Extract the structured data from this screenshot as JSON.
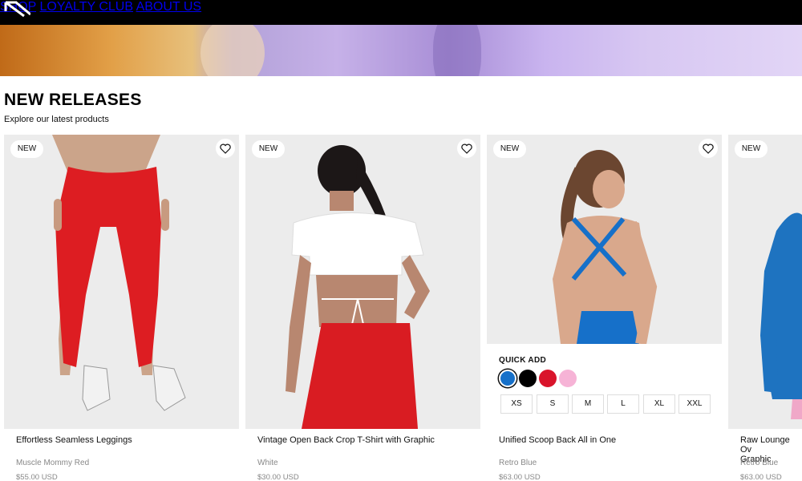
{
  "nav": {
    "items": [
      "SHOP",
      "LOYALTY CLUB",
      "ABOUT US"
    ]
  },
  "section": {
    "title": "NEW RELEASES",
    "subtitle": "Explore our latest products"
  },
  "products": [
    {
      "badge": "NEW",
      "name": "Effortless Seamless Leggings",
      "color": "Muscle Mommy Red",
      "price": "$55.00 USD"
    },
    {
      "badge": "NEW",
      "name": "Vintage Open Back Crop T-Shirt with Graphic",
      "color": "White",
      "price": "$30.00 USD"
    },
    {
      "badge": "NEW",
      "name": "Unified Scoop Back All in One",
      "color": "Retro Blue",
      "price": "$63.00 USD"
    },
    {
      "badge": "NEW",
      "name": "Raw Lounge Ov... Graphic",
      "name_line1": "Raw Lounge Ov",
      "name_line2": "Graphic",
      "color": "Retro Blue",
      "price": "$63.00 USD"
    }
  ],
  "quick_add": {
    "label": "QUICK ADD",
    "swatches": [
      "#1670c9",
      "#000000",
      "#d9142b",
      "#f6b3d6"
    ],
    "sizes": [
      "XS",
      "S",
      "M",
      "L",
      "XL",
      "XXL"
    ]
  },
  "colors": {
    "topbar": "#000000",
    "card_bg": "#ececec",
    "muted_text": "#888888"
  }
}
